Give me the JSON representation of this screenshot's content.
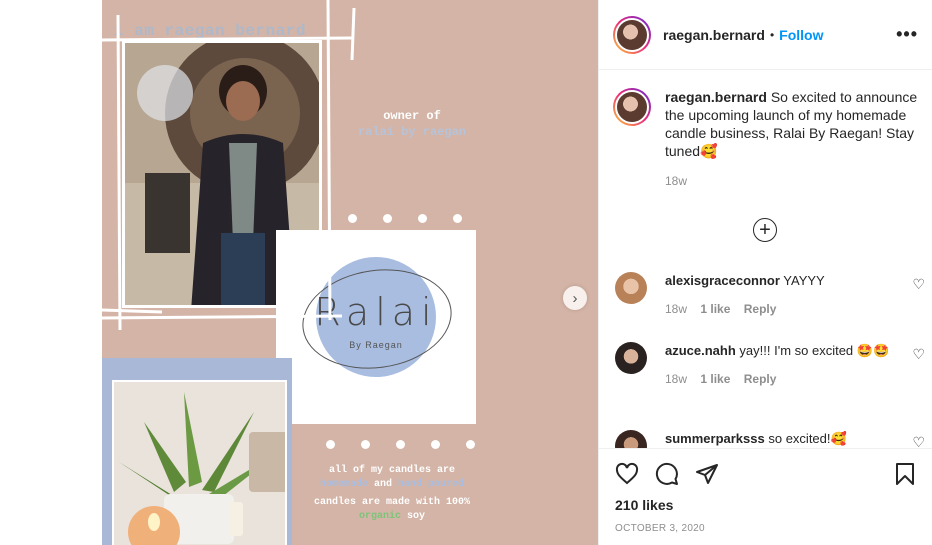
{
  "post_image": {
    "title": "i am raegan bernard",
    "owner_line1": "owner of",
    "owner_line2": "ralai by raegan",
    "logo_word": "Ralai",
    "logo_sub": "By Raegan",
    "text_line1": "all of my candles are",
    "text_homemade": "homemade",
    "text_and": "and",
    "text_handpoured": "hand poured",
    "text_line3": "candles are made with 100%",
    "text_organic": "organic",
    "text_soy": "soy"
  },
  "header": {
    "username": "raegan.bernard",
    "bullet": "•",
    "follow": "Follow",
    "more": "•••"
  },
  "caption": {
    "username": "raegan.bernard",
    "text": "So excited to announce the upcoming launch of my homemade candle business, Ralai By Raegan! Stay tuned🥰",
    "time": "18w"
  },
  "load_more": "+",
  "comments": [
    {
      "username": "alexisgraceconnor",
      "text": "YAYYY",
      "time": "18w",
      "likes": "1 like",
      "reply": "Reply"
    },
    {
      "username": "azuce.nahh",
      "text": "yay!!! I'm so excited 🤩🤩",
      "time": "18w",
      "likes": "1 like",
      "reply": "Reply"
    },
    {
      "username": "summerparksss",
      "text": "so excited!🥰",
      "time": "",
      "likes": "",
      "reply": ""
    }
  ],
  "actions": {
    "likes": "210 likes",
    "date": "OCTOBER 3, 2020"
  },
  "colors": {
    "link_blue": "#0095f6",
    "post_bg": "#d4b4a6",
    "accent_blue": "#a9bde1"
  }
}
